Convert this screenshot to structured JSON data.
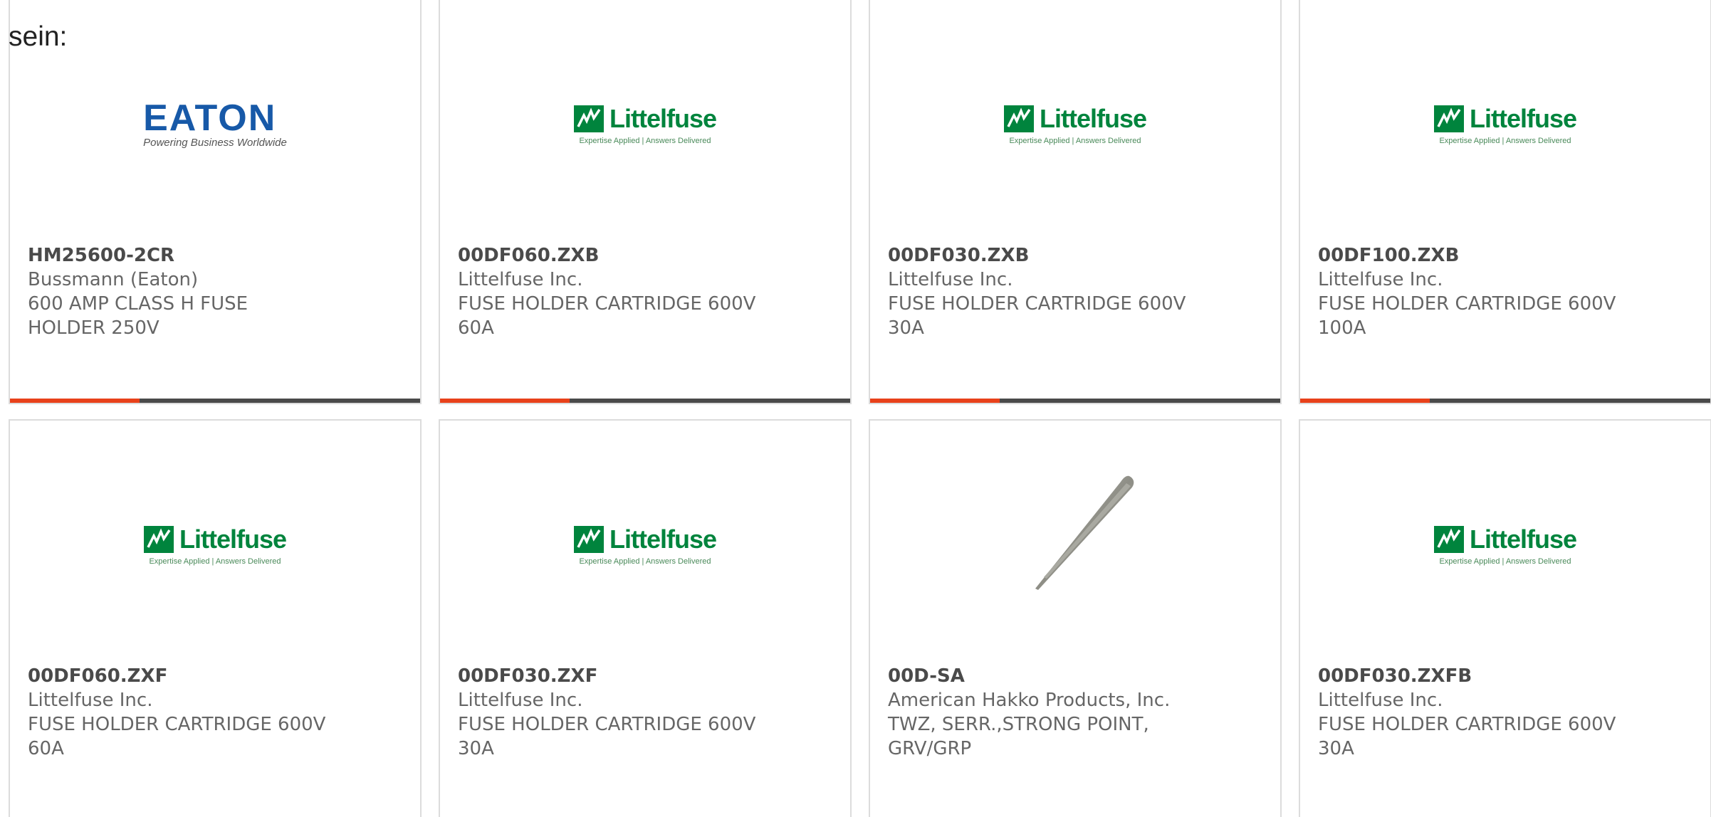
{
  "intro_text": "sein:",
  "colors": {
    "accent": "#e8411a",
    "bar": "#4a4a4a",
    "littelfuse_green": "#00843d",
    "eaton_blue": "#1759a8"
  },
  "logos": {
    "eaton": {
      "word": "EATON",
      "tagline": "Powering Business Worldwide"
    },
    "littelfuse": {
      "word": "Littelfuse",
      "tagline": "Expertise Applied  |  Answers Delivered"
    }
  },
  "products": [
    {
      "part_number": "HM25600-2CR",
      "manufacturer": "Bussmann (Eaton)",
      "description": "600 AMP CLASS H FUSE HOLDER 250V",
      "image": "eaton-logo"
    },
    {
      "part_number": "00DF060.ZXB",
      "manufacturer": "Littelfuse Inc.",
      "description": "FUSE HOLDER CARTRIDGE 600V 60A",
      "image": "littelfuse-logo"
    },
    {
      "part_number": "00DF030.ZXB",
      "manufacturer": "Littelfuse Inc.",
      "description": "FUSE HOLDER CARTRIDGE 600V 30A",
      "image": "littelfuse-logo"
    },
    {
      "part_number": "00DF100.ZXB",
      "manufacturer": "Littelfuse Inc.",
      "description": "FUSE HOLDER CARTRIDGE 600V 100A",
      "image": "littelfuse-logo"
    },
    {
      "part_number": "00DF060.ZXF",
      "manufacturer": "Littelfuse Inc.",
      "description": "FUSE HOLDER CARTRIDGE 600V 60A",
      "image": "littelfuse-logo"
    },
    {
      "part_number": "00DF030.ZXF",
      "manufacturer": "Littelfuse Inc.",
      "description": "FUSE HOLDER CARTRIDGE 600V 30A",
      "image": "littelfuse-logo"
    },
    {
      "part_number": "00D-SA",
      "manufacturer": "American Hakko Products, Inc.",
      "description": "TWZ, SERR.,STRONG POINT, GRV/GRP",
      "image": "tweezers-photo"
    },
    {
      "part_number": "00DF030.ZXFB",
      "manufacturer": "Littelfuse Inc.",
      "description": "FUSE HOLDER CARTRIDGE 600V 30A",
      "image": "littelfuse-logo"
    }
  ]
}
